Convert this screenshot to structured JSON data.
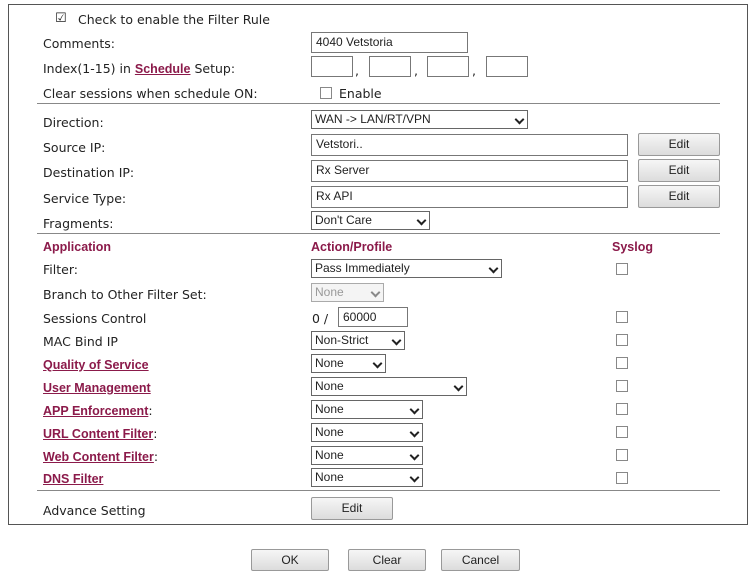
{
  "enable_rule": {
    "checked": true,
    "label": "Check to enable the Filter Rule"
  },
  "comments": {
    "label": "Comments:",
    "value": "4040 Vetstoria"
  },
  "index": {
    "label_prefix": "Index(1-15) in ",
    "link": "Schedule",
    "label_suffix": " Setup:",
    "separator": ","
  },
  "clear_sessions": {
    "label": "Clear sessions when schedule ON:",
    "checkbox_label": "Enable"
  },
  "direction": {
    "label": "Direction:",
    "value": "WAN -> LAN/RT/VPN"
  },
  "source_ip": {
    "label": "Source IP:",
    "value": "Vetstori..",
    "button": "Edit"
  },
  "destination_ip": {
    "label": "Destination IP:",
    "value": "Rx Server",
    "button": "Edit"
  },
  "service_type": {
    "label": "Service Type:",
    "value": "Rx API",
    "button": "Edit"
  },
  "fragments": {
    "label": "Fragments:",
    "value": "Don't Care"
  },
  "headers": {
    "application": "Application",
    "action": "Action/Profile",
    "syslog": "Syslog"
  },
  "rows": {
    "filter": {
      "label": "Filter:",
      "value": "Pass Immediately"
    },
    "branch": {
      "label": "Branch to Other Filter Set:",
      "value": "None"
    },
    "sessions": {
      "label": "Sessions Control",
      "prefix": "0 /",
      "value": "60000"
    },
    "mac": {
      "label": "MAC Bind IP",
      "value": "Non-Strict"
    },
    "qos": {
      "label": "Quality of Service",
      "value": "None"
    },
    "user_mgmt": {
      "label": "User Management",
      "value": "None"
    },
    "app_enf": {
      "label": "APP Enforcement",
      "suffix": ":",
      "value": "None"
    },
    "url_filter": {
      "label": "URL Content Filter",
      "suffix": ":",
      "value": "None"
    },
    "web_filter": {
      "label": "Web Content Filter",
      "suffix": ":",
      "value": "None"
    },
    "dns_filter": {
      "label": "DNS Filter",
      "value": "None"
    }
  },
  "advance": {
    "label": "Advance Setting",
    "button": "Edit"
  },
  "footer": {
    "ok": "OK",
    "clear": "Clear",
    "cancel": "Cancel"
  }
}
